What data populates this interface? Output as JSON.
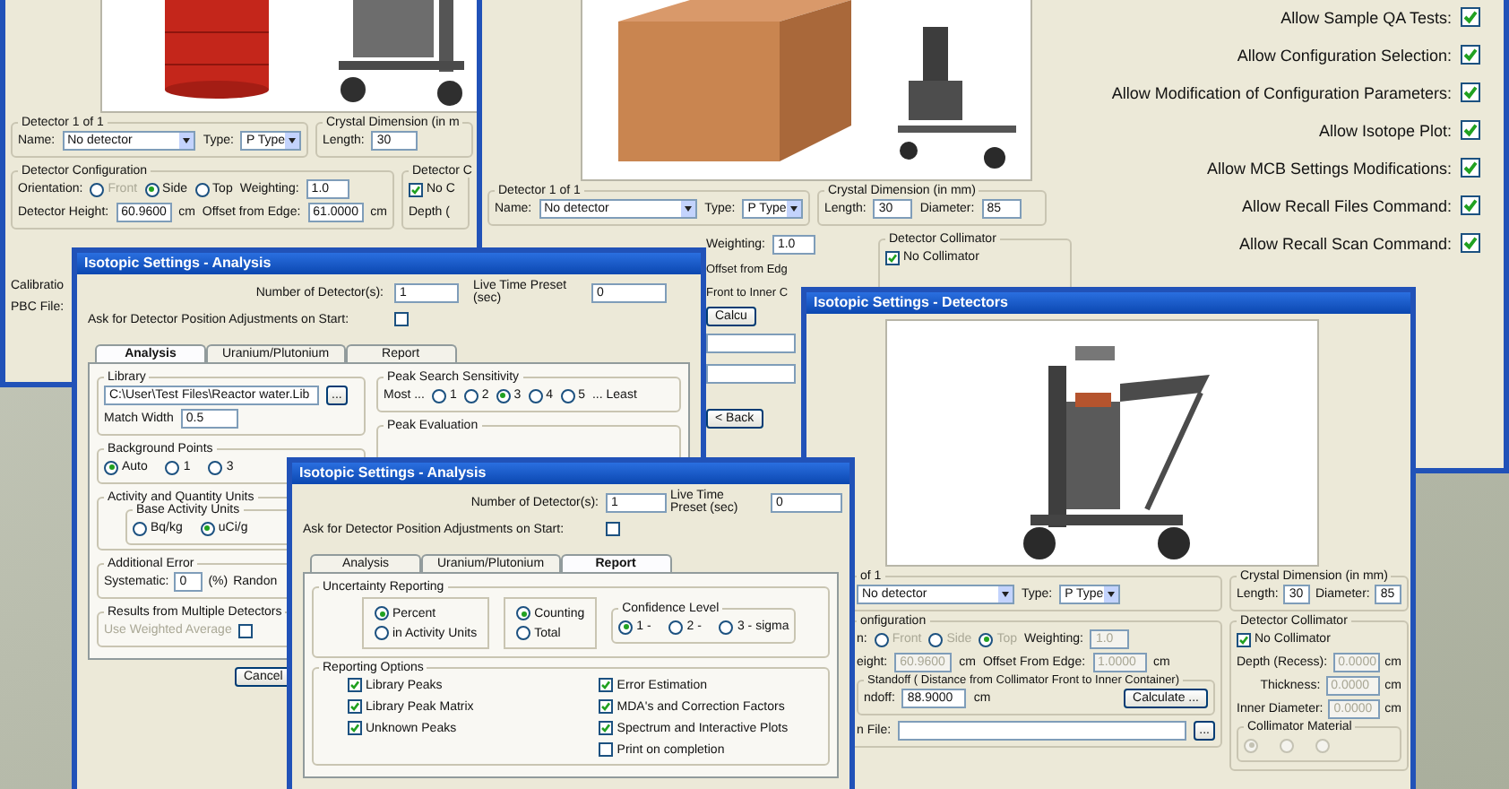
{
  "detectors_window_back": {
    "detector_group": {
      "title": "Detector 1 of 1",
      "name_label": "Name:",
      "name_value": "No detector",
      "type_label": "Type:",
      "type_value": "P Type"
    },
    "crystal_group": {
      "title": "Crystal Dimension (in m",
      "length_label": "Length:",
      "length_value": "30"
    },
    "configuration_group": {
      "title": "Detector Configuration",
      "orientation_label": "Orientation:",
      "orientations": [
        {
          "label": "Front",
          "selected": false,
          "disabled": true
        },
        {
          "label": "Side",
          "selected": true,
          "disabled": false
        },
        {
          "label": "Top",
          "selected": false,
          "disabled": false
        }
      ],
      "weighting_label": "Weighting:",
      "weighting_value": "1.0",
      "height_label": "Detector Height:",
      "height_value": "60.9600",
      "height_unit": "cm",
      "offset_label": "Offset from Edge:",
      "offset_value": "61.0000",
      "offset_unit": "cm"
    },
    "collimator_group": {
      "title": "Detector C",
      "no_collimator_label": "No C",
      "no_collimator_checked": true,
      "depth_label": "Depth ("
    },
    "footer_labels": [
      "Calibratio",
      "PBC File:"
    ]
  },
  "detectors_window_top": {
    "detector_group": {
      "title": "Detector 1 of 1",
      "name_label": "Name:",
      "name_value": "No detector",
      "type_label": "Type:",
      "type_value": "P Type"
    },
    "crystal_group": {
      "title": "Crystal Dimension (in mm)",
      "length_label": "Length:",
      "length_value": "30",
      "diameter_label": "Diameter:",
      "diameter_value": "85"
    },
    "weighting_label": "Weighting:",
    "weighting_value": "1.0",
    "side_labels": [
      "Offset from Edg",
      "Front to Inner C"
    ],
    "calculate_button": "Calcu",
    "back_button": "< Back",
    "collimator_group": {
      "title": "Detector Collimator",
      "no_collimator_label": "No Collimator",
      "no_collimator_checked": true
    },
    "permissions": [
      {
        "label": "Allow Sample QA Tests:",
        "checked": true
      },
      {
        "label": "Allow Configuration Selection:",
        "checked": true
      },
      {
        "label": "Allow Modification of Configuration Parameters:",
        "checked": true
      },
      {
        "label": "Allow Isotope Plot:",
        "checked": true
      },
      {
        "label": "Allow MCB Settings Modifications:",
        "checked": true
      },
      {
        "label": "Allow Recall Files Command:",
        "checked": true
      },
      {
        "label": "Allow Recall Scan Command:",
        "checked": true
      }
    ]
  },
  "analysis_window": {
    "title": "Isotopic Settings - Analysis",
    "detectors_label": "Number of Detector(s):",
    "detectors_value": "1",
    "live_time_label": "Live Time Preset (sec)",
    "live_time_value": "0",
    "ask_label": "Ask for Detector Position Adjustments on Start:",
    "ask_checked": false,
    "tabs": [
      {
        "label": "Analysis",
        "selected": true
      },
      {
        "label": "Uranium/Plutonium",
        "selected": false
      },
      {
        "label": "Report",
        "selected": false
      }
    ],
    "library": {
      "title": "Library",
      "path": "C:\\User\\Test Files\\Reactor water.Lib",
      "browse": "...",
      "match_width_label": "Match Width",
      "match_width_value": "0.5"
    },
    "peak_search": {
      "title": "Peak Search Sensitivity",
      "most_label": "Most ...",
      "least_label": "... Least",
      "options": [
        {
          "label": "1",
          "selected": false
        },
        {
          "label": "2",
          "selected": false
        },
        {
          "label": "3",
          "selected": true
        },
        {
          "label": "4",
          "selected": false
        },
        {
          "label": "5",
          "selected": false
        }
      ]
    },
    "peak_evaluation_title": "Peak Evaluation",
    "background_points": {
      "title": "Background Points",
      "options": [
        {
          "label": "Auto",
          "selected": true
        },
        {
          "label": "1",
          "selected": false
        },
        {
          "label": "3",
          "selected": false
        }
      ]
    },
    "units": {
      "title": "Activity and Quantity Units",
      "base_title": "Base Activity Units",
      "options": [
        {
          "label": "Bq/kg",
          "selected": false
        },
        {
          "label": "uCi/g",
          "selected": true
        }
      ]
    },
    "additional_error": {
      "title": "Additional Error",
      "systematic_label": "Systematic:",
      "systematic_value": "0",
      "percent_label": "(%)",
      "random_label": "Randon"
    },
    "multi_detectors": {
      "title": "Results from Multiple Detectors",
      "weighted_label": "Use Weighted Average",
      "weighted_checked": false,
      "disabled": true
    },
    "cancel_button": "Cancel"
  },
  "detectors_window": {
    "title": "Isotopic Settings - Detectors",
    "detector_group": {
      "title": "of 1",
      "name_value": "No detector",
      "type_label": "Type:",
      "type_value": "P Type"
    },
    "crystal_group": {
      "title": "Crystal Dimension (in mm)",
      "length_label": "Length:",
      "length_value": "30",
      "diameter_label": "Diameter:",
      "diameter_value": "85"
    },
    "configuration": {
      "title": "onfiguration",
      "disabled": true,
      "orientation_label": "n:",
      "orientations": [
        {
          "label": "Front",
          "selected": false,
          "disabled": true
        },
        {
          "label": "Side",
          "selected": false,
          "disabled": true
        },
        {
          "label": "Top",
          "selected": true,
          "disabled": true
        }
      ],
      "weighting_label": "Weighting:",
      "weighting_value": "1.0",
      "height_label": "eight:",
      "height_value": "60.9600",
      "height_unit": "cm",
      "offset_label": "Offset From Edge:",
      "offset_value": "1.0000",
      "offset_unit": "cm",
      "standoff": {
        "title": "Standoff ( Distance from Collimator Front to Inner Container)",
        "label": "ndoff:",
        "value": "88.9000",
        "unit": "cm",
        "button": "Calculate ..."
      },
      "file_label": "n File:",
      "browse": "..."
    },
    "collimator": {
      "title": "Detector Collimator",
      "no_collimator_label": "No Collimator",
      "no_collimator_checked": true,
      "fields": [
        {
          "label": "Depth (Recess):",
          "value": "0.0000",
          "unit": "cm",
          "disabled": true
        },
        {
          "label": "Thickness:",
          "value": "0.0000",
          "unit": "cm",
          "disabled": true
        },
        {
          "label": "Inner Diameter:",
          "value": "0.0000",
          "unit": "cm",
          "disabled": true
        }
      ],
      "material_title": "Collimator Material",
      "material_options": [
        {
          "selected": true,
          "disabled": true
        },
        {
          "selected": false,
          "disabled": true
        },
        {
          "selected": false,
          "disabled": true
        }
      ]
    }
  },
  "analysis_report_window": {
    "title": "Isotopic Settings - Analysis",
    "detectors_label": "Number of Detector(s):",
    "detectors_value": "1",
    "live_time_label": "Live Time Preset (sec)",
    "live_time_value": "0",
    "ask_label": "Ask for Detector Position Adjustments on Start:",
    "ask_checked": false,
    "tabs": [
      {
        "label": "Analysis",
        "selected": false
      },
      {
        "label": "Uranium/Plutonium",
        "selected": false
      },
      {
        "label": "Report",
        "selected": true
      }
    ],
    "uncertainty": {
      "title": "Uncertainty Reporting",
      "units": [
        {
          "label": "Percent",
          "selected": true
        },
        {
          "label": "in Activity Units",
          "selected": false
        }
      ],
      "mode": [
        {
          "label": "Counting",
          "selected": true
        },
        {
          "label": "Total",
          "selected": false
        }
      ],
      "confidence_title": "Confidence Level",
      "confidence": [
        {
          "label": "1 -",
          "selected": true
        },
        {
          "label": "2 -",
          "selected": false
        },
        {
          "label": "3 - sigma",
          "selected": false
        }
      ]
    },
    "reporting": {
      "title": "Reporting Options",
      "left": [
        {
          "label": "Library Peaks",
          "checked": true
        },
        {
          "label": "Library Peak Matrix",
          "checked": true
        },
        {
          "label": "Unknown Peaks",
          "checked": true
        }
      ],
      "right": [
        {
          "label": "Error Estimation",
          "checked": true
        },
        {
          "label": "MDA's and  Correction Factors",
          "checked": true
        },
        {
          "label": "Spectrum and Interactive Plots",
          "checked": true
        },
        {
          "label": "Print on completion",
          "checked": false
        }
      ]
    }
  }
}
